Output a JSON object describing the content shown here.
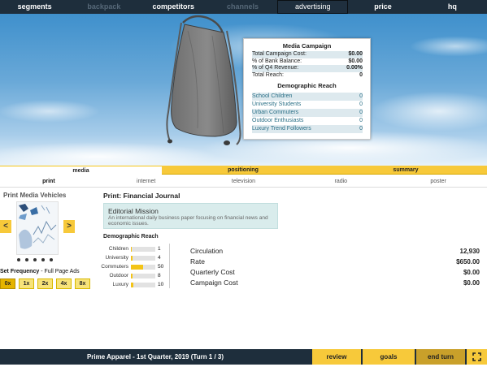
{
  "nav": {
    "items": [
      {
        "label": "segments",
        "state": "normal"
      },
      {
        "label": "backpack",
        "state": "dim"
      },
      {
        "label": "competitors",
        "state": "normal"
      },
      {
        "label": "channels",
        "state": "dim"
      },
      {
        "label": "advertising",
        "state": "active"
      },
      {
        "label": "price",
        "state": "normal"
      },
      {
        "label": "hq",
        "state": "normal"
      }
    ]
  },
  "campaign": {
    "title": "Media Campaign",
    "rows": [
      {
        "label": "Total Campaign Cost:",
        "value": "$0.00"
      },
      {
        "label": "% of Bank Balance:",
        "value": "$0.00"
      },
      {
        "label": "% of Q4 Revenue:",
        "value": "0.00%"
      },
      {
        "label": "Total Reach:",
        "value": "0"
      }
    ],
    "demo_title": "Demographic Reach",
    "demo_rows": [
      {
        "label": "School Children",
        "value": "0"
      },
      {
        "label": "University Students",
        "value": "0"
      },
      {
        "label": "Urban Commuters",
        "value": "0"
      },
      {
        "label": "Outdoor Enthusiasts",
        "value": "0"
      },
      {
        "label": "Luxury Trend Followers",
        "value": "0"
      }
    ]
  },
  "main_tabs": {
    "media": "media",
    "positioning": "positioning",
    "summary": "summary"
  },
  "sub_tabs": {
    "print": "print",
    "internet": "internet",
    "television": "television",
    "radio": "radio",
    "poster": "poster"
  },
  "vehicles": {
    "title": "Print Media Vehicles",
    "prev": "<",
    "next": ">",
    "frequency_label": "Set Frequency",
    "frequency_detail": " - Full Page Ads",
    "frequency_options": [
      "0x",
      "1x",
      "2x",
      "4x",
      "8x"
    ],
    "frequency_selected": 0
  },
  "detail": {
    "title": "Print: Financial Journal",
    "mission_title": "Editorial Mission",
    "mission_text": "An international daily business paper focusing on financial news and economic issues.",
    "demo_title": "Demographic Reach",
    "demo": [
      {
        "label": "Children",
        "value": 1,
        "fill": 0.02
      },
      {
        "label": "University",
        "value": 4,
        "fill": 0.08
      },
      {
        "label": "Commuters",
        "value": 50,
        "fill": 0.5
      },
      {
        "label": "Outdoor",
        "value": 8,
        "fill": 0.08
      },
      {
        "label": "Luxury",
        "value": 10,
        "fill": 0.1
      }
    ],
    "stats": [
      {
        "label": "Circulation",
        "value": "12,930"
      },
      {
        "label": "Rate",
        "value": "$650.00"
      },
      {
        "label": "Quarterly Cost",
        "value": "$0.00"
      },
      {
        "label": "Campaign Cost",
        "value": "$0.00"
      }
    ]
  },
  "bottom": {
    "turn_text": "Prime Apparel - 1st Quarter, 2019 (Turn 1 / 3)",
    "review": "review",
    "goals": "goals",
    "end_turn": "end turn"
  },
  "colors": {
    "nav_bg": "#1e2e3c",
    "accent_yellow": "#f7c93a",
    "bar_fill": "#f3c418",
    "mission_bg": "#d9ecec"
  },
  "icons": {
    "expand": "expand-icon",
    "prev": "chevron-left-icon",
    "next": "chevron-right-icon"
  }
}
